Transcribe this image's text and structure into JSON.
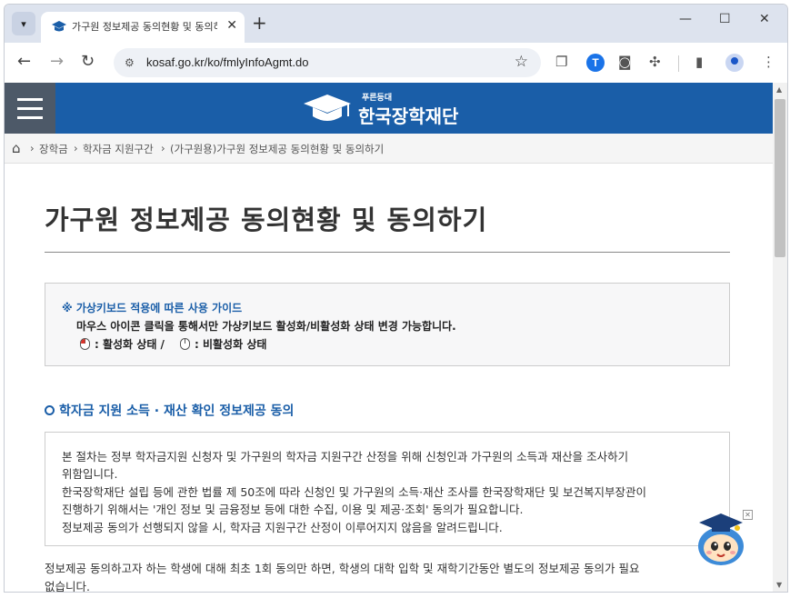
{
  "browser": {
    "tab_title": "가구원 정보제공 동의현황 및 동의하",
    "url": "kosaf.go.kr/ko/fmlyInfoAgmt.do",
    "tab_close": "✕",
    "new_tab": "+",
    "minimize": "—",
    "maximize": "☐",
    "close": "✕",
    "extension_t": "T"
  },
  "site": {
    "logo_small": "푸른등대",
    "logo_name": "한국장학재단"
  },
  "breadcrumb": [
    "장학금",
    "학자금 지원구간",
    "(가구원용)가구원 정보제공 동의현황 및 동의하기"
  ],
  "page": {
    "title": "가구원 정보제공 동의현황 및 동의하기"
  },
  "guide": {
    "title": "※ 가상키보드 적용에 따른 사용 가이드",
    "line1": "마우스 아이콘 클릭을 통해서만 가상키보드 활성화/비활성화 상태 변경 가능합니다.",
    "active": ": 활성화 상태 /",
    "inactive": ": 비활성화 상태"
  },
  "section": {
    "title": "학자금 지원 소득 · 재산 확인 정보제공 동의",
    "lines": [
      "본 절차는 정부 학자금지원 신청자 및 가구원의 학자금 지원구간 산정을 위해 신청인과 가구원의 소득과 재산을 조사하기",
      "위함입니다.",
      "한국장학재단 설립 등에 관한 법률 제 50조에 따라 신청인 및 가구원의 소득·재산 조사를 한국장학재단 및 보건복지부장관이",
      "진행하기 위해서는 '개인 정보 및 금융정보 등에 대한 수집, 이용 및 제공·조회' 동의가 필요합니다.",
      "정보제공 동의가 선행되지 않을 시, 학자금 지원구간 산정이 이루어지지 않음을 알려드립니다."
    ],
    "after": [
      "정보제공 동의하고자 하는 학생에 대해 최초 1회 동의만 하면, 학생의 대학 입학 및 재학기간동안 별도의 정보제공 동의가 필요",
      "없습니다."
    ]
  },
  "chatbot": {
    "close": "✕"
  }
}
